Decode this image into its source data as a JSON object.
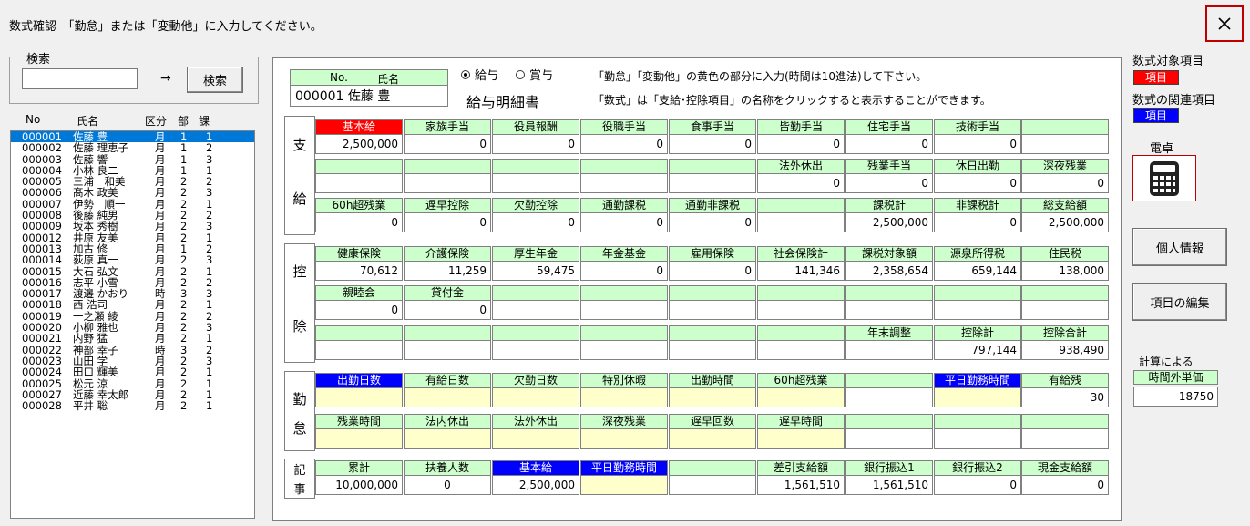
{
  "window": {
    "title": "数式確認　「勤怠」または「変動他」に入力してください。"
  },
  "search": {
    "legend": "検索",
    "value": "",
    "arrow": "→",
    "button_label": "検索"
  },
  "employee_list": {
    "headers": [
      "No",
      "氏名",
      "区分",
      "部",
      "課"
    ],
    "rows": [
      [
        "000001",
        "佐藤 豊",
        "月",
        "1",
        "1"
      ],
      [
        "000002",
        "佐藤 理恵子",
        "月",
        "1",
        "2"
      ],
      [
        "000003",
        "佐藤 響",
        "月",
        "1",
        "3"
      ],
      [
        "000004",
        "小林 良二",
        "月",
        "1",
        "1"
      ],
      [
        "000005",
        "三浦　和美",
        "月",
        "2",
        "2"
      ],
      [
        "000006",
        "髙木 政美",
        "月",
        "2",
        "3"
      ],
      [
        "000007",
        "伊勢　順一",
        "月",
        "2",
        "1"
      ],
      [
        "000008",
        "後藤 純男",
        "月",
        "2",
        "2"
      ],
      [
        "000009",
        "坂本 秀樹",
        "月",
        "2",
        "3"
      ],
      [
        "000012",
        "井原 友美",
        "月",
        "2",
        "1"
      ],
      [
        "000013",
        "加古 修",
        "月",
        "1",
        "2"
      ],
      [
        "000014",
        "荻原 真一",
        "月",
        "2",
        "3"
      ],
      [
        "000015",
        "大石 弘文",
        "月",
        "2",
        "1"
      ],
      [
        "000016",
        "志平 小雪",
        "月",
        "2",
        "2"
      ],
      [
        "000017",
        "渡邉 かおり",
        "時",
        "3",
        "3"
      ],
      [
        "000018",
        "西 浩司",
        "月",
        "2",
        "1"
      ],
      [
        "000019",
        "一之瀬 綾",
        "月",
        "2",
        "2"
      ],
      [
        "000020",
        "小柳 雅也",
        "月",
        "2",
        "3"
      ],
      [
        "000021",
        "内野 猛",
        "月",
        "2",
        "1"
      ],
      [
        "000022",
        "神部 幸子",
        "時",
        "3",
        "2"
      ],
      [
        "000023",
        "山田 学",
        "月",
        "2",
        "3"
      ],
      [
        "000024",
        "田口 輝美",
        "月",
        "2",
        "1"
      ],
      [
        "000025",
        "松元 涼",
        "月",
        "2",
        "1"
      ],
      [
        "000027",
        "近藤 幸太郎",
        "月",
        "2",
        "1"
      ],
      [
        "000028",
        "平井 聡",
        "月",
        "2",
        "1"
      ]
    ],
    "selected_index": 0
  },
  "header": {
    "no_label": "No.",
    "name_label": "氏名",
    "employee": "000001 佐藤 豊",
    "radio_salary": "給与",
    "radio_bonus": "賞与",
    "doc_title": "給与明細書",
    "note1": "「勤怠」「変動他」の黄色の部分に入力(時間は10進法)して下さい。",
    "note2": "「数式」は「支給･控除項目」の名称をクリックすると表示することができます。"
  },
  "sections": {
    "shikyu": [
      "支",
      "給"
    ],
    "kojo": [
      "控",
      "除"
    ],
    "kintai": [
      "勤",
      "怠"
    ],
    "kiji": [
      "記",
      "事"
    ]
  },
  "shikyu": {
    "r1_h": [
      "基本給",
      "家族手当",
      "役員報酬",
      "役職手当",
      "食事手当",
      "皆勤手当",
      "住宅手当",
      "技術手当",
      ""
    ],
    "r1_v": [
      "2,500,000",
      "0",
      "0",
      "0",
      "0",
      "0",
      "0",
      "0",
      ""
    ],
    "r2_h": [
      "",
      "",
      "",
      "",
      "",
      "法外休出",
      "残業手当",
      "休日出勤",
      "深夜残業"
    ],
    "r2_v": [
      "",
      "",
      "",
      "",
      "",
      "0",
      "0",
      "0",
      "0"
    ],
    "r3_h": [
      "60h超残業",
      "遅早控除",
      "欠勤控除",
      "通勤課税",
      "通勤非課税",
      "",
      "課税計",
      "非課税計",
      "総支給額"
    ],
    "r3_v": [
      "0",
      "0",
      "0",
      "0",
      "0",
      "",
      "2,500,000",
      "0",
      "2,500,000"
    ]
  },
  "kojo": {
    "r1_h": [
      "健康保険",
      "介護保険",
      "厚生年金",
      "年金基金",
      "雇用保険",
      "社会保険計",
      "課税対象額",
      "源泉所得税",
      "住民税"
    ],
    "r1_v": [
      "70,612",
      "11,259",
      "59,475",
      "0",
      "0",
      "141,346",
      "2,358,654",
      "659,144",
      "138,000"
    ],
    "r2_h": [
      "親睦会",
      "貸付金",
      "",
      "",
      "",
      "",
      "",
      "",
      ""
    ],
    "r2_v": [
      "0",
      "0",
      "",
      "",
      "",
      "",
      "",
      "",
      ""
    ],
    "r3_h": [
      "",
      "",
      "",
      "",
      "",
      "",
      "年末調整",
      "控除計",
      "控除合計"
    ],
    "r3_v": [
      "",
      "",
      "",
      "",
      "",
      "",
      "",
      "797,144",
      "938,490"
    ]
  },
  "kintai": {
    "r1_h": [
      "出勤日数",
      "有給日数",
      "欠勤日数",
      "特別休暇",
      "出勤時間",
      "60h超残業",
      "",
      "平日勤務時間",
      "有給残"
    ],
    "r1_v": [
      "",
      "",
      "",
      "",
      "",
      "",
      "",
      "",
      "30"
    ],
    "r2_h": [
      "残業時間",
      "法内休出",
      "法外休出",
      "深夜残業",
      "遅早回数",
      "遅早時間",
      "",
      "",
      ""
    ],
    "r2_v": [
      "",
      "",
      "",
      "",
      "",
      "",
      "",
      "",
      ""
    ]
  },
  "kiji": {
    "r1_h": [
      "累計",
      "扶養人数",
      "基本給",
      "平日勤務時間",
      "",
      "差引支給額",
      "銀行振込1",
      "銀行振込2",
      "現金支給額"
    ],
    "r1_v": [
      "10,000,000",
      "0",
      "2,500,000",
      "",
      "",
      "1,561,510",
      "1,561,510",
      "0",
      "0"
    ]
  },
  "right": {
    "formula_target_label": "数式対象項目",
    "formula_target_tag": "項目",
    "formula_related_label": "数式の関連項目",
    "formula_related_tag": "項目",
    "calculator_label": "電卓",
    "personal_info_button": "個人情報",
    "edit_items_button": "項目の編集",
    "calc_by_label": "計算による",
    "overtime_rate_label": "時間外単価",
    "overtime_rate_value": "18750"
  },
  "colors": {
    "header_green": "#ccffcc",
    "input_yellow": "#ffffcc",
    "red": "#ff0000",
    "blue": "#0000ff",
    "selection": "#0078d7"
  },
  "icons": {
    "close": "close-icon",
    "calculator": "calculator-icon"
  }
}
